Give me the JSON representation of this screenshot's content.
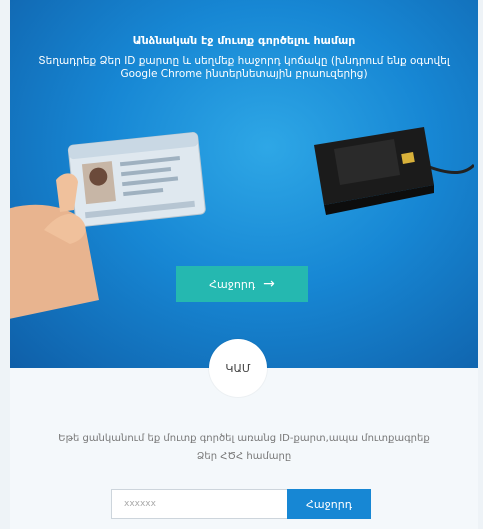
{
  "hero": {
    "title": "Անձնական էջ մուտք գործելու համար",
    "subtitle": "Տեղադրեք Ձեր ID քարտը և սեղմեք հաջորդ կոճակը (խնդրում ենք օգտվել Google Chrome ինտերնետային բրաուզերից)",
    "next_label": "Հաջորդ",
    "next_icon": "arrow-right-icon"
  },
  "divider": {
    "or_label": "ԿԱՄ"
  },
  "alt_login": {
    "instruction": "Եթե ցանկանում եք մուտք գործել առանց ID-քարտ,ապա մուտքագրեք Ձեր ՀԾՀ համարը",
    "input_placeholder": "xxxxxx",
    "input_value": "",
    "submit_label": "Հաջորդ"
  },
  "colors": {
    "hero_blue": "#1787d4",
    "teal_button": "#25b8b0",
    "submit_blue": "#1787d4"
  }
}
